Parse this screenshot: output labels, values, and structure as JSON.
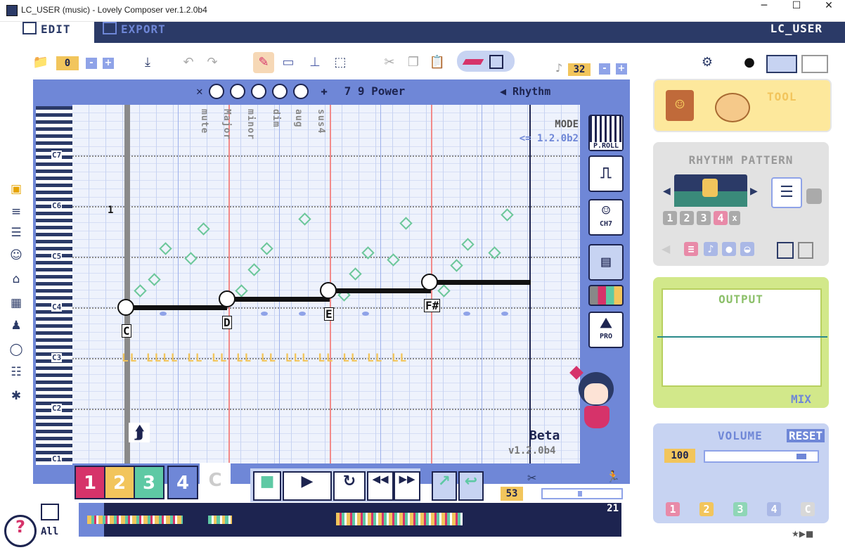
{
  "window": {
    "title": "LC_USER  (music)  - Lovely Composer ver.1.2.0b4",
    "minimize": "─",
    "maximize": "☐",
    "close": "✕"
  },
  "header": {
    "tab_edit": "EDIT",
    "tab_export": "EXPORT",
    "user": "LC_USER"
  },
  "toolbar": {
    "folder_icon": "📁",
    "song_number": "0",
    "minus": "-",
    "plus": "+",
    "download_icon": "⤓",
    "undo_icon": "↶",
    "redo_icon": "↷",
    "pencil_icon": "✎",
    "tool2_icon": "▭",
    "tool3_icon": "⊥",
    "select_icon": "⬚",
    "cut_icon": "✂",
    "copy_icon": "❐",
    "paste_icon": "📋",
    "note_icon": "♪",
    "length_value": "32",
    "settings_icon": "⚙",
    "bomb_icon": "●"
  },
  "editor": {
    "header_plus": "✚",
    "chord_sym": "7 9 Power",
    "rhythm_label": "◀ Rhythm",
    "chord_words": [
      "mute",
      "Major",
      "minor",
      "dim",
      "aug",
      "sus4"
    ],
    "mode_label": "MODE",
    "mode_value": "<= 1.2.0b2",
    "marker_one": "1",
    "octaves": [
      "C7",
      "C6",
      "C5",
      "C4",
      "C3",
      "C2",
      "C1"
    ],
    "chords": [
      "C",
      "D",
      "E",
      "F#"
    ],
    "rhythm_row": "LL  LLLL  LL  LL  LL  LL  LLL  LL  LL  LL  LL",
    "beta": "Beta",
    "version": "v1.2.0b4",
    "side_buttons": [
      "P.ROLL",
      "",
      "CH7",
      "",
      "",
      "PRO"
    ]
  },
  "transport": {
    "tracks": [
      "1",
      "2",
      "3",
      "4",
      "C"
    ],
    "stop_icon": "■",
    "play_icon": "▶",
    "loop_icon": "↻",
    "rewind_icon": "◀◀",
    "ffwd_icon": "▶▶",
    "loop_left_icon": "↗",
    "loop_right_icon": "↩",
    "tempo": "53",
    "timeline_end": "21",
    "all_label": "All",
    "help_icon": "?"
  },
  "right": {
    "tool_label": "TOOL",
    "rhythm_pattern_label": "RHYTHM PATTERN",
    "rp_numbers": [
      "1",
      "2",
      "3",
      "4"
    ],
    "rp_x": "x",
    "output_label": "OUTPUT",
    "mix_label": "MIX",
    "volume_label": "VOLUME",
    "reset_label": "RESET",
    "volume_value": "100",
    "channels": [
      "1",
      "2",
      "3",
      "4",
      "C"
    ],
    "footer": "★▶■"
  },
  "colors": {
    "navy": "#2b3a67",
    "track1": "#d6336a",
    "track2": "#f2c55c",
    "track3": "#5ec9a4",
    "track4": "#6f87d7",
    "trackC": "#ffffff"
  }
}
